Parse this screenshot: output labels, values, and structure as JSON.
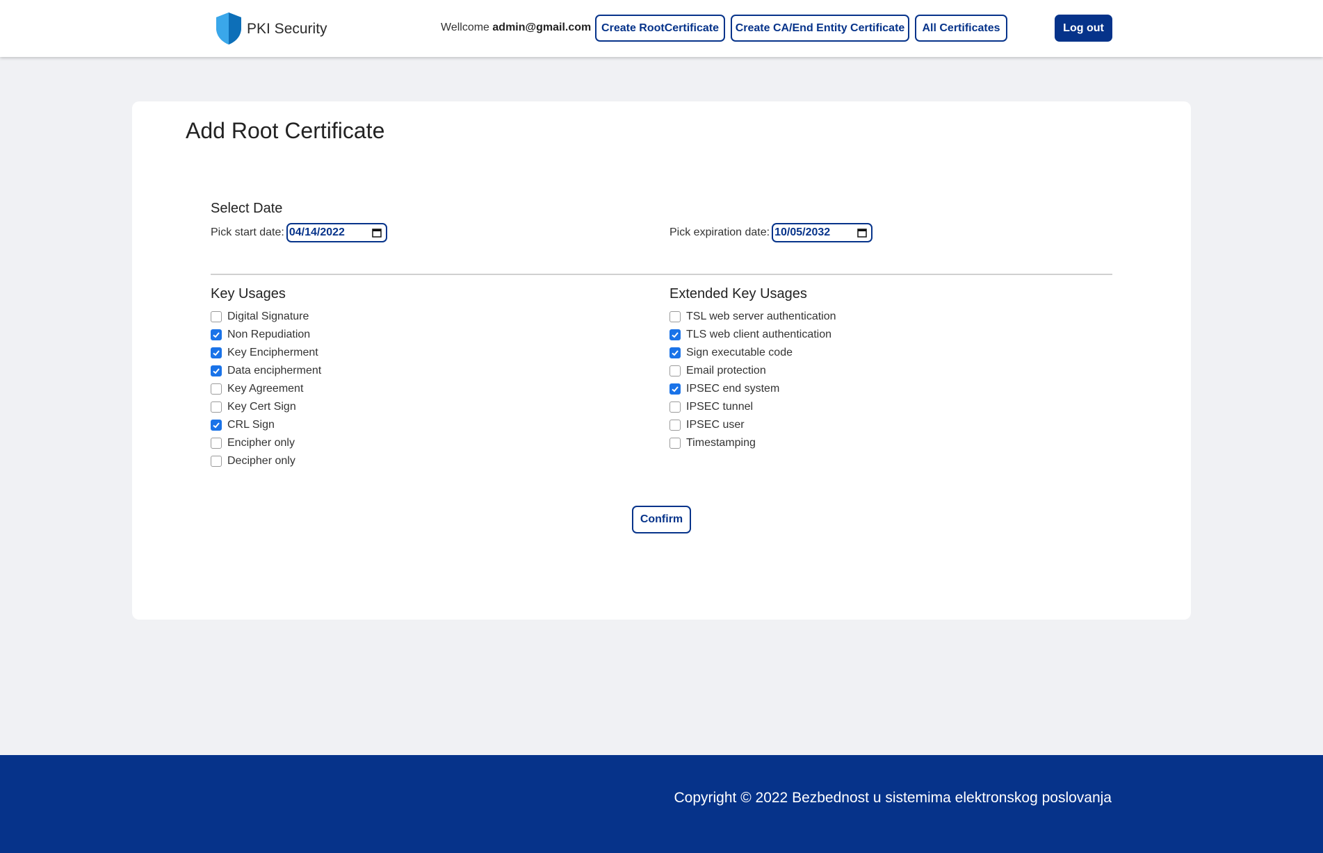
{
  "brand": {
    "name": "PKI Security",
    "logo_icon": "shield-icon",
    "logo_color": "#1e8fd8"
  },
  "header": {
    "welcome_prefix": "Wellcome ",
    "user_email": "admin@gmail.com",
    "nav": {
      "create_root": "Create RootCertificate",
      "create_ca": "Create CA/End Entity Certificate",
      "all_certs": "All Certificates"
    },
    "logout": "Log out"
  },
  "form": {
    "title": "Add Root Certificate",
    "select_date_title": "Select Date",
    "start_label": "Pick start date:",
    "start_value": "04/14/2022",
    "expiration_label": "Pick expiration date:",
    "expiration_value": "10/05/2032",
    "key_usages_title": "Key Usages",
    "key_usages": [
      {
        "label": "Digital Signature",
        "checked": false
      },
      {
        "label": "Non Repudiation",
        "checked": true
      },
      {
        "label": "Key Encipherment",
        "checked": true
      },
      {
        "label": "Data encipherment",
        "checked": true
      },
      {
        "label": "Key Agreement",
        "checked": false
      },
      {
        "label": "Key Cert Sign",
        "checked": false
      },
      {
        "label": "CRL Sign",
        "checked": true
      },
      {
        "label": "Encipher only",
        "checked": false
      },
      {
        "label": "Decipher only",
        "checked": false
      }
    ],
    "extended_title": "Extended Key Usages",
    "extended_key_usages": [
      {
        "label": "TSL web server authentication",
        "checked": false
      },
      {
        "label": "TLS web client authentication",
        "checked": true
      },
      {
        "label": "Sign executable code",
        "checked": true
      },
      {
        "label": "Email protection",
        "checked": false
      },
      {
        "label": "IPSEC end system",
        "checked": true
      },
      {
        "label": "IPSEC tunnel",
        "checked": false
      },
      {
        "label": "IPSEC user",
        "checked": false
      },
      {
        "label": "Timestamping",
        "checked": false
      }
    ],
    "confirm": "Confirm"
  },
  "footer": {
    "copyright": "Copyright © 2022 Bezbednost u sistemima elektronskog poslovanja"
  },
  "colors": {
    "primary": "#06338a",
    "checkbox": "#1a73e8",
    "page_bg": "#f0f1f4"
  }
}
